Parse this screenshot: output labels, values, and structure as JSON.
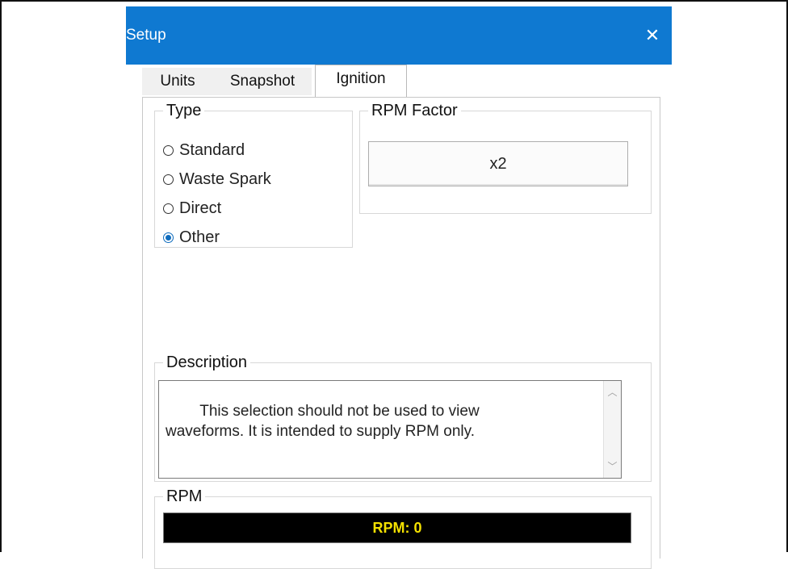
{
  "window": {
    "title": "Setup",
    "close_symbol": "✕"
  },
  "tabs": [
    {
      "label": "Units",
      "selected": false
    },
    {
      "label": "Snapshot",
      "selected": false
    },
    {
      "label": "Ignition",
      "selected": true
    }
  ],
  "type_group": {
    "label": "Type",
    "options": [
      {
        "label": "Standard",
        "checked": false
      },
      {
        "label": "Waste Spark",
        "checked": false
      },
      {
        "label": "Direct",
        "checked": false
      },
      {
        "label": "Other",
        "checked": true
      }
    ]
  },
  "rpm_factor": {
    "label": "RPM Factor",
    "value": "x2"
  },
  "description": {
    "label": "Description",
    "text": "This selection should not be used to view\nwaveforms. It is intended to supply RPM only."
  },
  "rpm": {
    "label": "RPM",
    "display": "RPM: 0"
  },
  "colors": {
    "titlebar": "#0f79d1",
    "rpm_text": "#f3e000",
    "radio_checked": "#0f6cbd"
  }
}
